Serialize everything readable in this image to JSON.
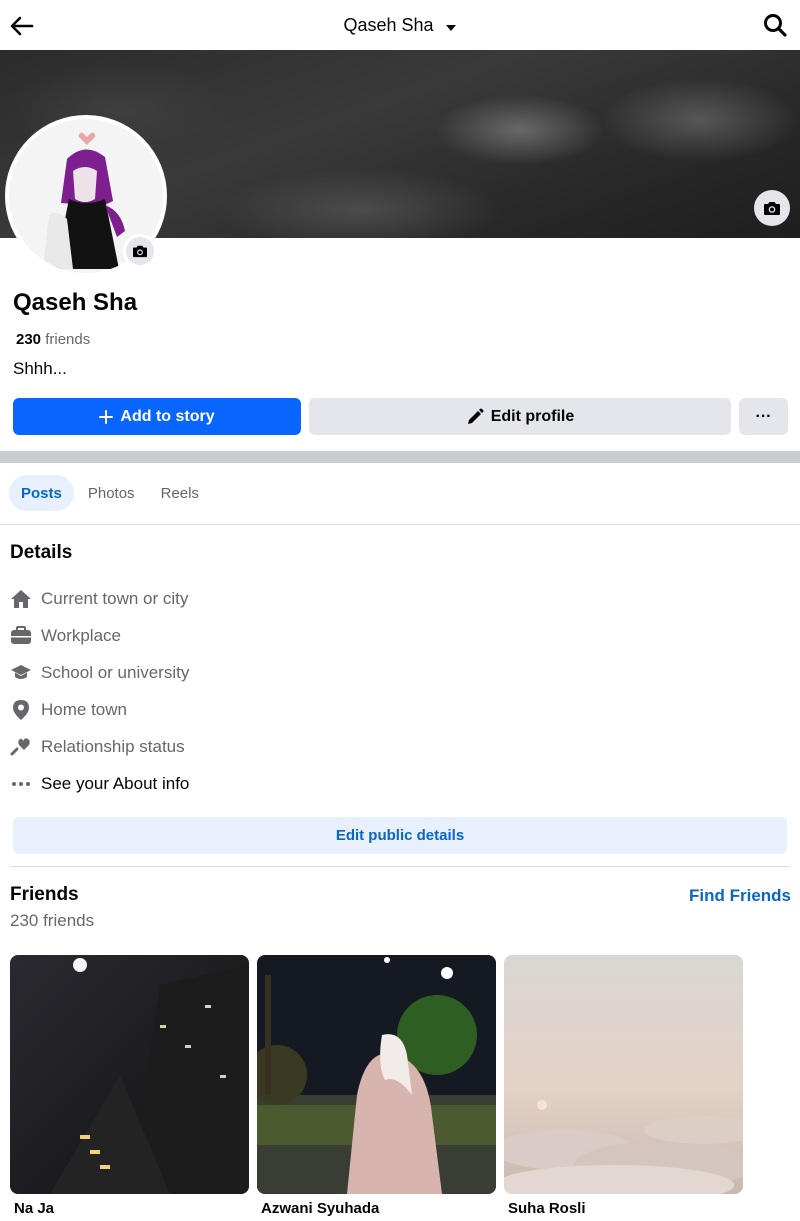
{
  "header": {
    "title": "Qaseh Sha",
    "back_icon": "arrow-left-icon",
    "dropdown_icon": "caret-down-icon",
    "search_icon": "search-icon"
  },
  "profile": {
    "name": "Qaseh Sha",
    "friend_count": "230",
    "friend_count_label": "friends",
    "bio": "Shhh..."
  },
  "actions": {
    "add_to_story": "Add to story",
    "edit_profile": "Edit profile",
    "more": "···"
  },
  "tabs": [
    {
      "label": "Posts",
      "active": true
    },
    {
      "label": "Photos",
      "active": false
    },
    {
      "label": "Reels",
      "active": false
    }
  ],
  "details": {
    "title": "Details",
    "items": [
      {
        "label": "Current town or city",
        "icon": "home-icon"
      },
      {
        "label": "Workplace",
        "icon": "briefcase-icon"
      },
      {
        "label": "School or university",
        "icon": "graduation-cap-icon"
      },
      {
        "label": "Home town",
        "icon": "location-pin-icon"
      },
      {
        "label": "Relationship status",
        "icon": "heart-icon"
      },
      {
        "label": "See your About info",
        "icon": "more-dots-icon"
      }
    ],
    "edit_button": "Edit public details"
  },
  "friends": {
    "title": "Friends",
    "count_text": "230 friends",
    "find_friends": "Find Friends",
    "list": [
      {
        "name": "Na Ja"
      },
      {
        "name": "Azwani Syuhada"
      },
      {
        "name": "Suha Rosli"
      }
    ]
  },
  "colors": {
    "accent": "#0866ff",
    "link": "#0a66c2",
    "button_grey": "#e4e6eb",
    "tab_active_bg": "#e7f0fc"
  }
}
